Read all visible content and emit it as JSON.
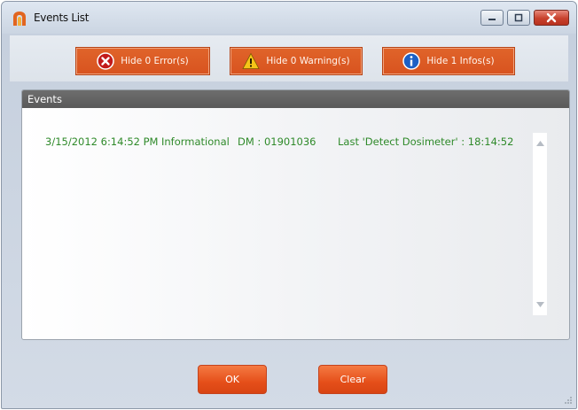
{
  "window": {
    "title": "Events List",
    "icon": "app-logo-icon",
    "controls": {
      "minimize_icon": "minimize-icon",
      "maximize_icon": "maximize-icon",
      "close_icon": "close-icon"
    }
  },
  "filters": [
    {
      "label": "Hide 0 Error(s)",
      "icon": "error-icon"
    },
    {
      "label": "Hide 0 Warning(s)",
      "icon": "warning-icon"
    },
    {
      "label": "Hide 1 Infos(s)",
      "icon": "info-icon"
    }
  ],
  "events_panel": {
    "header": "Events",
    "rows": [
      {
        "datetime": "3/15/2012 6:14:52 PM",
        "type": "Informational",
        "device": "DM : 01901036",
        "message": "Last 'Detect Dosimeter' : 18:14:52"
      }
    ]
  },
  "buttons": {
    "ok": "OK",
    "clear": "Clear"
  },
  "colors": {
    "accent": "#e0642a",
    "event_text": "#2f8a2a",
    "panel_header": "#626262"
  }
}
